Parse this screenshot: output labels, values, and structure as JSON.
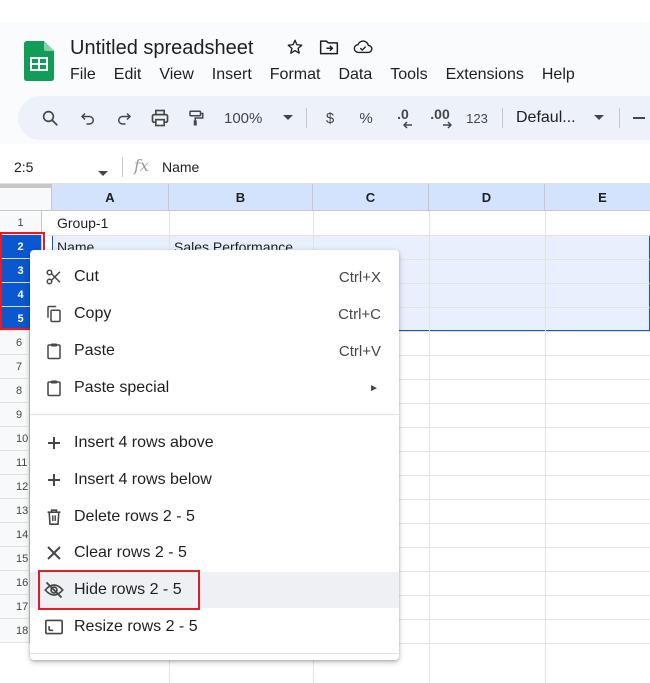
{
  "header": {
    "doc_title": "Untitled spreadsheet",
    "menu": [
      "File",
      "Edit",
      "View",
      "Insert",
      "Format",
      "Data",
      "Tools",
      "Extensions",
      "Help"
    ]
  },
  "toolbar": {
    "zoom": "100%",
    "currency": "$",
    "percent": "%",
    "decrease_decimal": ".0",
    "increase_decimal": ".00",
    "number_format": "123",
    "font": "Defaul..."
  },
  "formula_bar": {
    "name_box": "2:5",
    "fx": "fx",
    "value": "Name"
  },
  "grid": {
    "columns": [
      "A",
      "B",
      "C",
      "D",
      "E"
    ],
    "rows": [
      "1",
      "2",
      "3",
      "4",
      "5",
      "6",
      "7",
      "8",
      "9",
      "10",
      "11",
      "12",
      "13",
      "14",
      "15",
      "16",
      "17",
      "18"
    ],
    "cells": {
      "a1": "Group-1",
      "a2": "Name",
      "b2": "Sales Performance"
    }
  },
  "context_menu": {
    "cut": {
      "label": "Cut",
      "shortcut": "Ctrl+X"
    },
    "copy": {
      "label": "Copy",
      "shortcut": "Ctrl+C"
    },
    "paste": {
      "label": "Paste",
      "shortcut": "Ctrl+V"
    },
    "paste_special": {
      "label": "Paste special",
      "arrow": "►"
    },
    "insert_above": {
      "label": "Insert 4 rows above"
    },
    "insert_below": {
      "label": "Insert 4 rows below"
    },
    "delete_rows": {
      "label": "Delete rows 2 - 5"
    },
    "clear_rows": {
      "label": "Clear rows 2 - 5"
    },
    "hide_rows": {
      "label": "Hide rows 2 - 5"
    },
    "resize_rows": {
      "label": "Resize rows 2 - 5"
    }
  },
  "colors": {
    "selection": "#0b57d0",
    "selection_band": "#e8f0fe",
    "highlight": "#e11d2a",
    "sheets_green": "#0f9d58"
  }
}
